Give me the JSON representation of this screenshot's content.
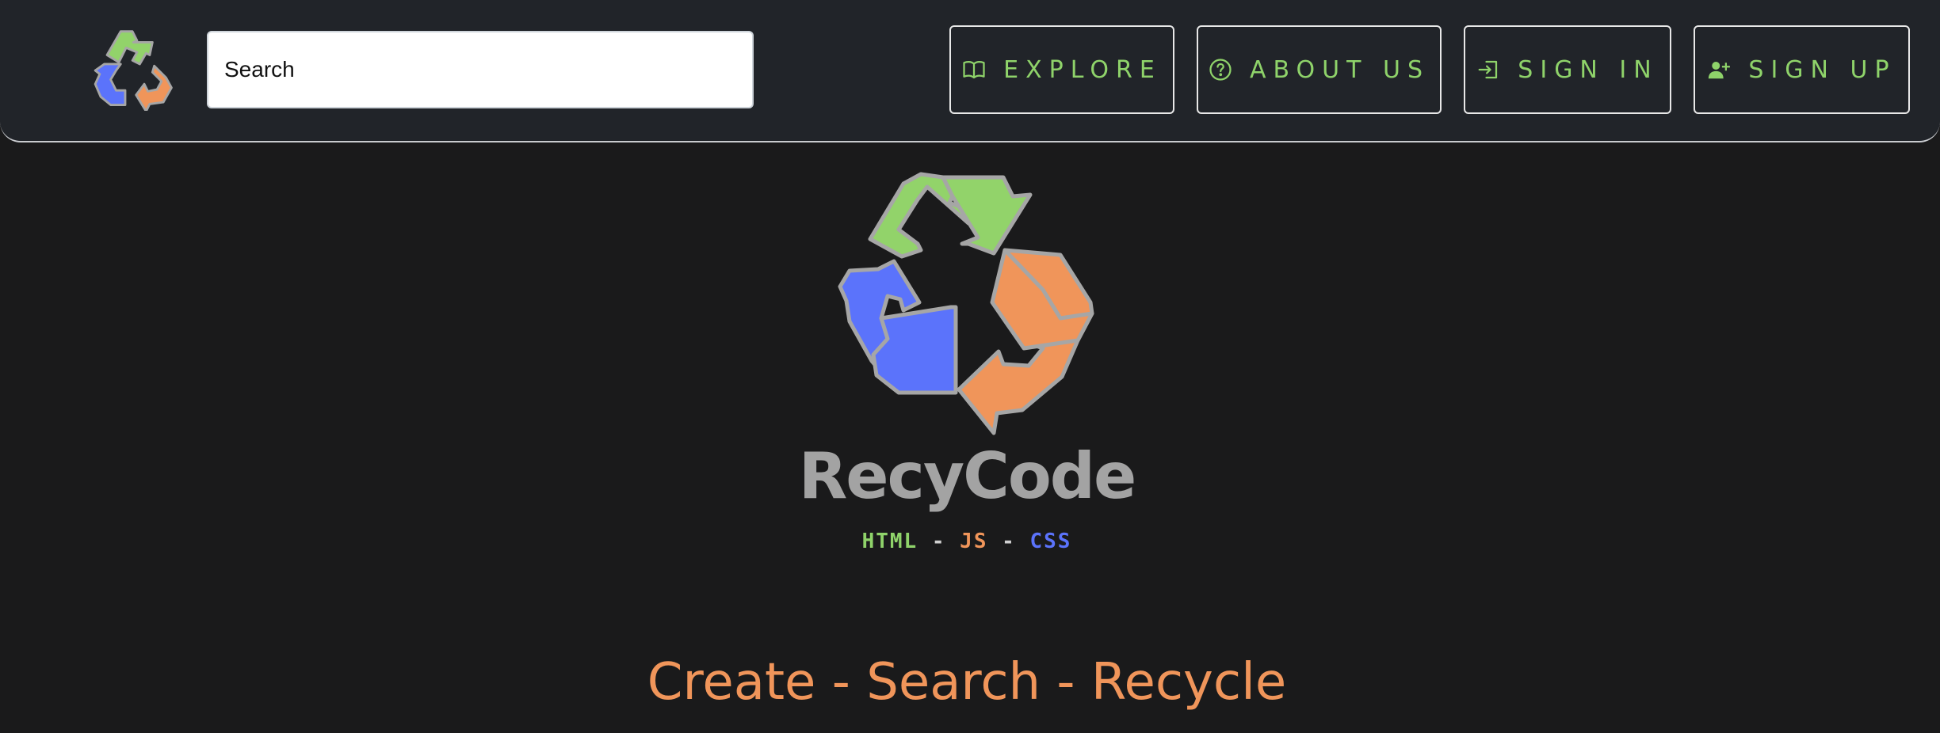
{
  "colors": {
    "green": "#8fd36a",
    "orange": "#f0955a",
    "blue": "#5b73fb",
    "gray": "#a3a3a3",
    "navbar_bg": "#212429",
    "page_bg": "#1a1a1b"
  },
  "header": {
    "logo_icon": "recycle-logo-icon",
    "search": {
      "value": "",
      "placeholder": "Search"
    },
    "nav": [
      {
        "label": "EXPLORE",
        "icon": "book-icon"
      },
      {
        "label": "ABOUT US",
        "icon": "question-circle-icon"
      },
      {
        "label": "SIGN IN",
        "icon": "sign-in-icon"
      },
      {
        "label": "SIGN UP",
        "icon": "person-plus-icon"
      }
    ]
  },
  "hero": {
    "logo_icon": "recycle-logo-icon",
    "brand": "RecyCode",
    "langs": {
      "html": "HTML",
      "sep1": " - ",
      "js": "JS",
      "sep2": " - ",
      "css": "CSS"
    },
    "tagline": "Create - Search - Recycle"
  }
}
